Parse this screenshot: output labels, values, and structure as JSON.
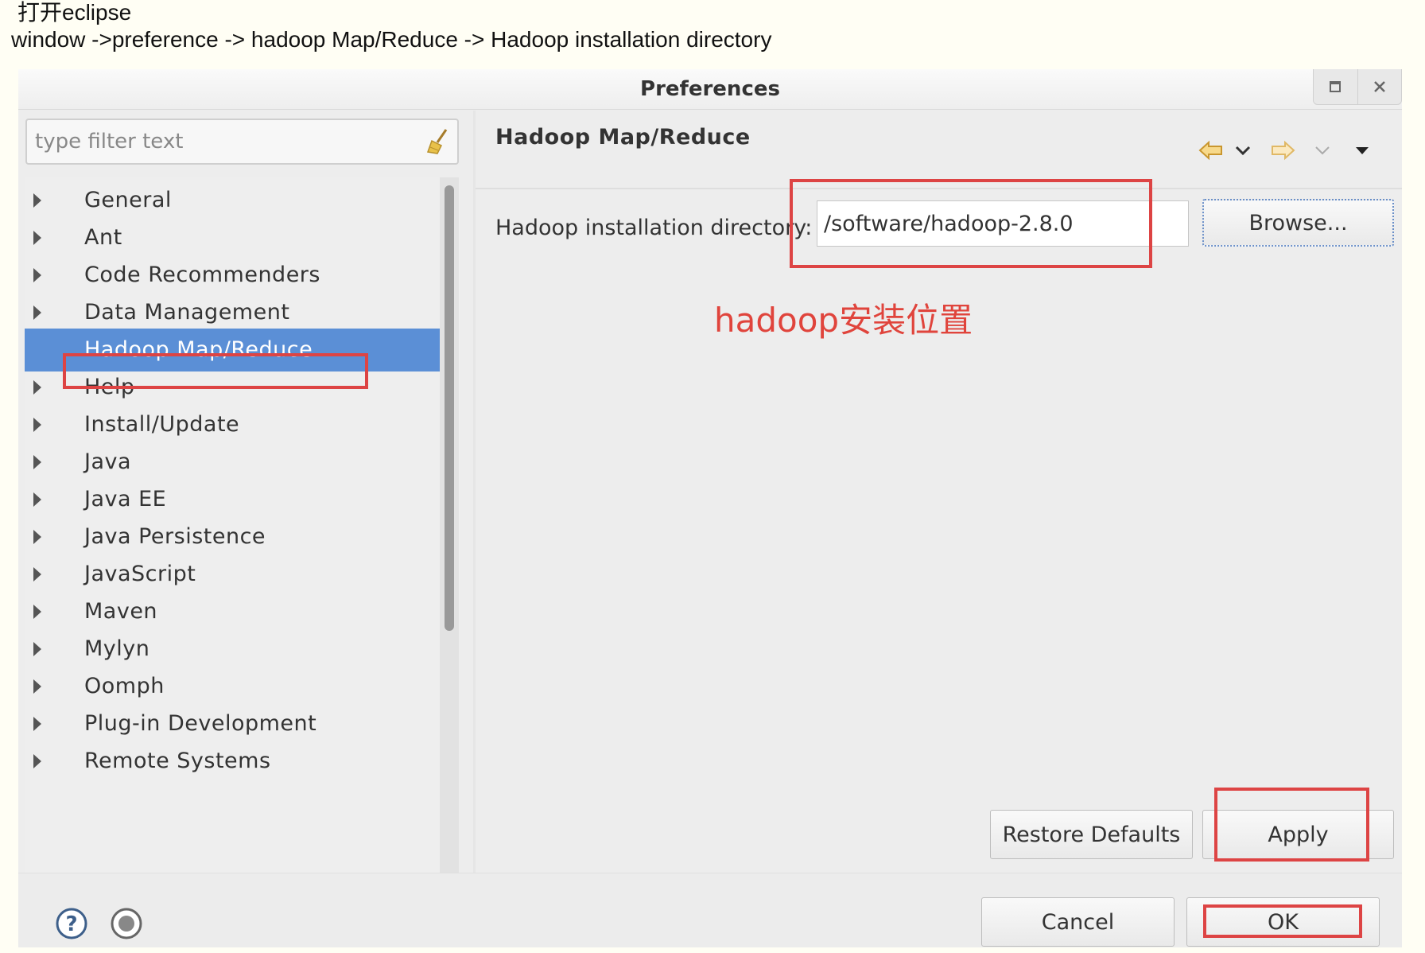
{
  "notes": {
    "line1": "打开eclipse",
    "line2": "window ->preference -> hadoop Map/Reduce -> Hadoop installation directory"
  },
  "window": {
    "title": "Preferences",
    "controls": [
      "maximize-icon",
      "close-icon"
    ]
  },
  "sidebar": {
    "filter_placeholder": "type filter text",
    "clear_icon": "broom-icon",
    "items": [
      {
        "label": "General",
        "expandable": true
      },
      {
        "label": "Ant",
        "expandable": true
      },
      {
        "label": "Code Recommenders",
        "expandable": true
      },
      {
        "label": "Data Management",
        "expandable": true
      },
      {
        "label": "Hadoop Map/Reduce",
        "expandable": false,
        "selected": true
      },
      {
        "label": "Help",
        "expandable": true
      },
      {
        "label": "Install/Update",
        "expandable": true
      },
      {
        "label": "Java",
        "expandable": true
      },
      {
        "label": "Java EE",
        "expandable": true
      },
      {
        "label": "Java Persistence",
        "expandable": true
      },
      {
        "label": "JavaScript",
        "expandable": true
      },
      {
        "label": "Maven",
        "expandable": true
      },
      {
        "label": "Mylyn",
        "expandable": true
      },
      {
        "label": "Oomph",
        "expandable": true
      },
      {
        "label": "Plug-in Development",
        "expandable": true
      },
      {
        "label": "Remote Systems",
        "expandable": true
      }
    ]
  },
  "page": {
    "title": "Hadoop Map/Reduce",
    "nav_icons": [
      "back-arrow-icon",
      "back-menu-chevron-icon",
      "forward-arrow-icon",
      "forward-menu-chevron-icon",
      "view-menu-icon"
    ],
    "field_label": "Hadoop installation directory:",
    "field_value": "/software/hadoop-2.8.0",
    "browse_label": "Browse...",
    "annotation": "hadoop安装位置",
    "annotation_color": "#e0443c"
  },
  "buttons": {
    "restore_defaults": "Restore Defaults",
    "apply": "Apply",
    "cancel": "Cancel",
    "ok": "OK"
  },
  "footer_icons": [
    "help-icon",
    "record-icon"
  ],
  "colors": {
    "selection": "#5b8fd6",
    "highlight_box": "#dd4444"
  }
}
